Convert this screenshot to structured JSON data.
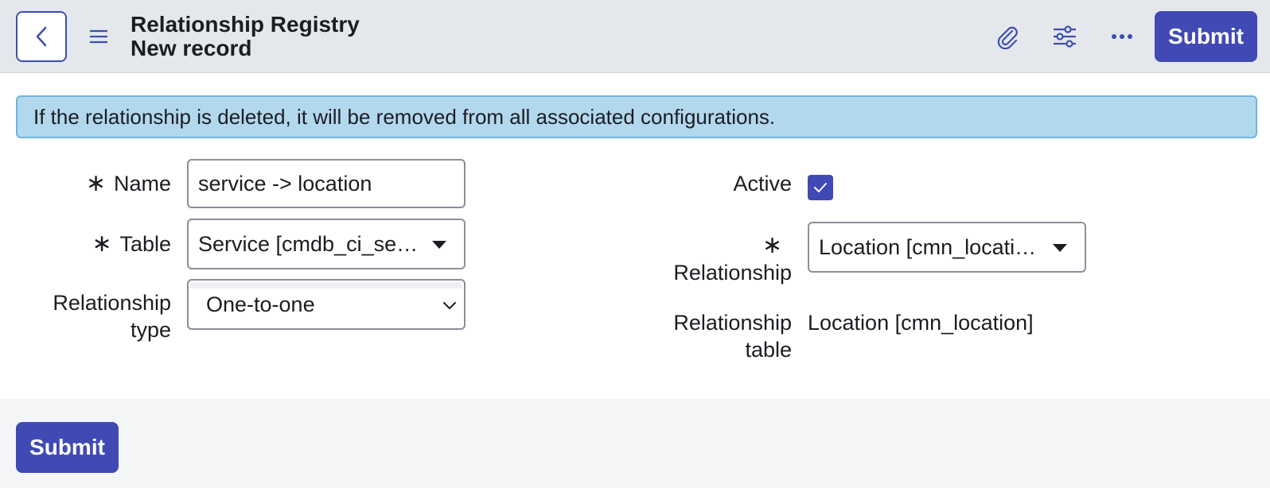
{
  "header": {
    "title": "Relationship Registry",
    "subtitle": "New record",
    "back_icon": "chevron-left-icon",
    "menu_icon": "hamburger-menu-icon",
    "attachment_icon": "paperclip-icon",
    "settings_icon": "sliders-icon",
    "more_icon": "more-horizontal-icon",
    "submit_label": "Submit"
  },
  "alert": {
    "message": "If the relationship is deleted, it will be removed from all associated configurations."
  },
  "form": {
    "name": {
      "label": "Name",
      "required_mark": "∗",
      "value": "service -> location"
    },
    "table": {
      "label": "Table",
      "required_mark": "∗",
      "value": "Service [cmdb_ci_ser…"
    },
    "relationship_type": {
      "label_line1": "Relationship",
      "label_line2": "type",
      "value": "One-to-one"
    },
    "active": {
      "label": "Active",
      "checked": true
    },
    "relationship": {
      "label": "Relationship",
      "required_mark": "∗",
      "value": "Location [cmn_locati…"
    },
    "relationship_table": {
      "label_line1": "Relationship",
      "label_line2": "table",
      "value": "Location [cmn_location]"
    }
  },
  "footer": {
    "submit_label": "Submit"
  },
  "colors": {
    "primary": "#4049b4",
    "header_bg": "#e4e8ec",
    "alert_bg": "#b2d8ee",
    "alert_border": "#6fb5dd"
  }
}
